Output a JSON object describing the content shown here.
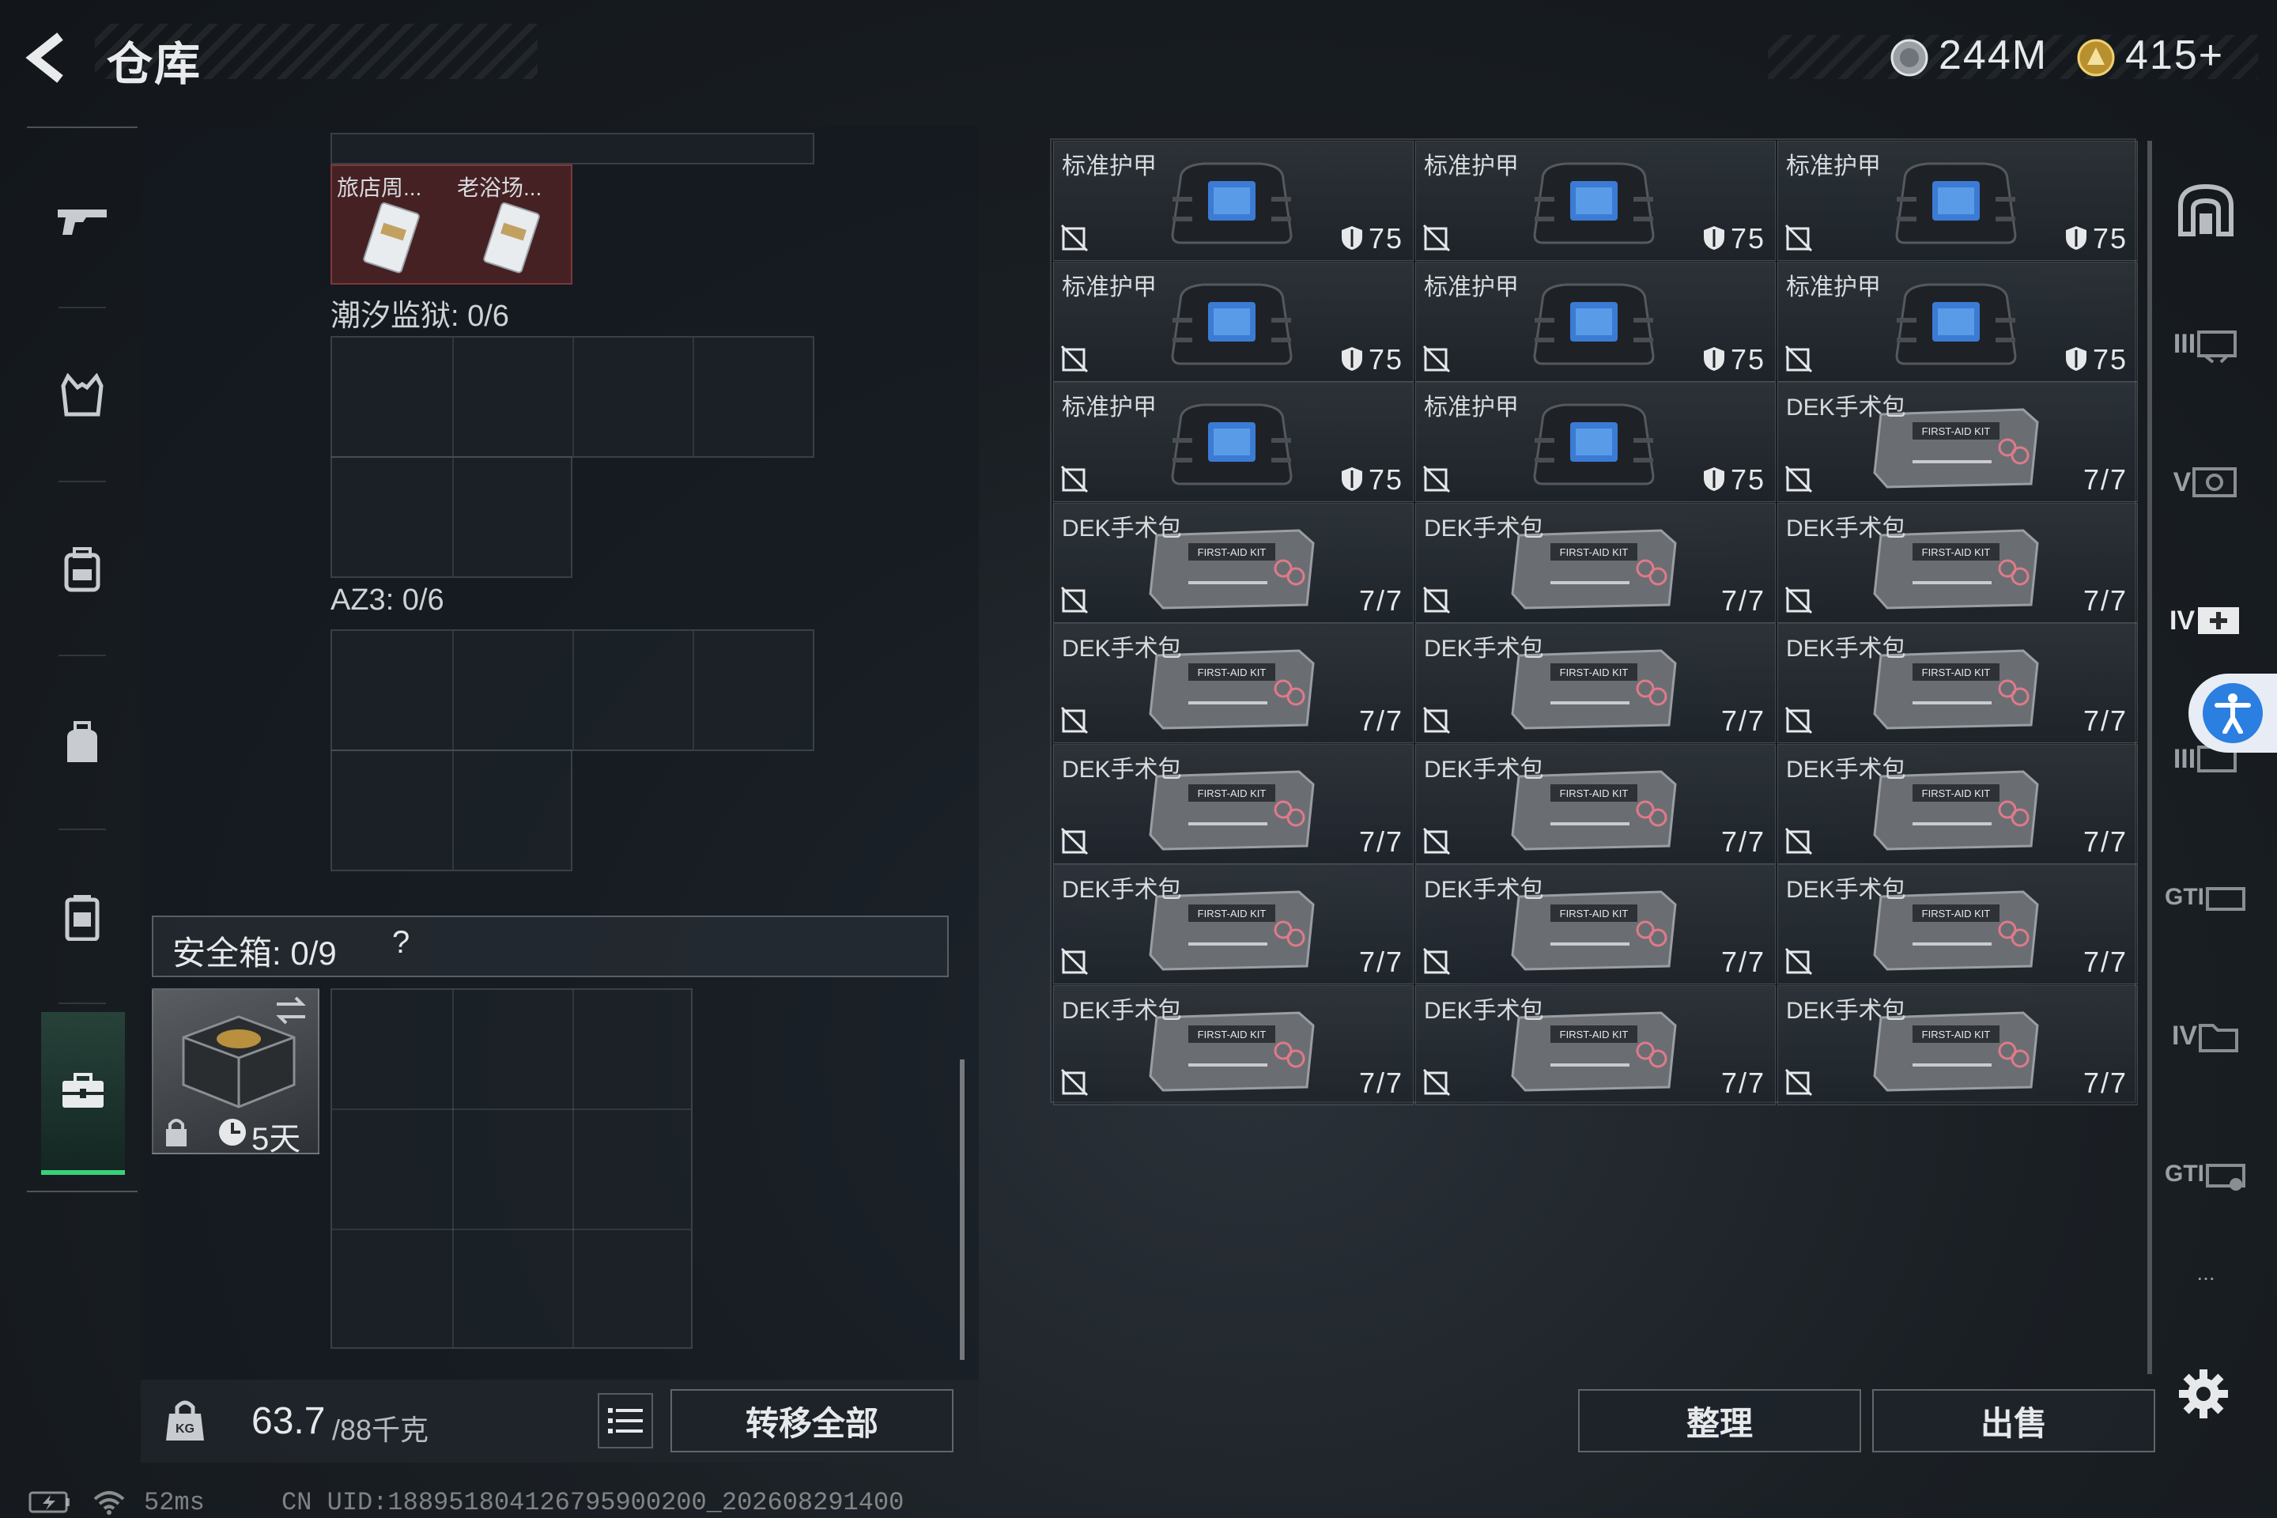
{
  "header": {
    "title": "仓库",
    "currency_silver": "244M",
    "currency_gold": "415+"
  },
  "left_nav": {
    "items": [
      "gun-icon",
      "vest-icon",
      "backpack-icon",
      "bag-icon",
      "canister-icon",
      "case-icon"
    ],
    "active_index": 5
  },
  "container": {
    "top_items": [
      {
        "label": "旅店周..."
      },
      {
        "label": "老浴场..."
      }
    ],
    "sections": [
      {
        "label": "潮汐监狱: 0/6"
      },
      {
        "label": "AZ3: 0/6"
      }
    ],
    "safe_box": {
      "label": "安全箱: 0/9",
      "help": "?",
      "duration": "5天"
    }
  },
  "bottom_left": {
    "weight": "63.7",
    "weight_max": "/88千克",
    "transfer_label": "转移全部"
  },
  "storage": {
    "slots": [
      {
        "name": "标准护甲",
        "type": "armor",
        "count": "75"
      },
      {
        "name": "标准护甲",
        "type": "armor",
        "count": "75"
      },
      {
        "name": "标准护甲",
        "type": "armor",
        "count": "75"
      },
      {
        "name": "标准护甲",
        "type": "armor",
        "count": "75"
      },
      {
        "name": "标准护甲",
        "type": "armor",
        "count": "75"
      },
      {
        "name": "标准护甲",
        "type": "armor",
        "count": "75"
      },
      {
        "name": "标准护甲",
        "type": "armor",
        "count": "75"
      },
      {
        "name": "标准护甲",
        "type": "armor",
        "count": "75"
      },
      {
        "name": "DEK手术包",
        "type": "kit",
        "count": "7/7"
      },
      {
        "name": "DEK手术包",
        "type": "kit",
        "count": "7/7"
      },
      {
        "name": "DEK手术包",
        "type": "kit",
        "count": "7/7"
      },
      {
        "name": "DEK手术包",
        "type": "kit",
        "count": "7/7"
      },
      {
        "name": "DEK手术包",
        "type": "kit",
        "count": "7/7"
      },
      {
        "name": "DEK手术包",
        "type": "kit",
        "count": "7/7"
      },
      {
        "name": "DEK手术包",
        "type": "kit",
        "count": "7/7"
      },
      {
        "name": "DEK手术包",
        "type": "kit",
        "count": "7/7"
      },
      {
        "name": "DEK手术包",
        "type": "kit",
        "count": "7/7"
      },
      {
        "name": "DEK手术包",
        "type": "kit",
        "count": "7/7"
      },
      {
        "name": "DEK手术包",
        "type": "kit",
        "count": "7/7"
      },
      {
        "name": "DEK手术包",
        "type": "kit",
        "count": "7/7"
      },
      {
        "name": "DEK手术包",
        "type": "kit",
        "count": "7/7"
      },
      {
        "name": "DEK手术包",
        "type": "kit",
        "count": "7/7"
      },
      {
        "name": "DEK手术包",
        "type": "kit",
        "count": "7/7"
      },
      {
        "name": "DEK手术包",
        "type": "kit",
        "count": "7/7"
      }
    ],
    "kit_label": "FIRST-AID KIT"
  },
  "right_nav": {
    "items": [
      {
        "icon": "arch-icon",
        "label": ""
      },
      {
        "icon": "tier-3-armor-icon",
        "label": "III"
      },
      {
        "icon": "tier-5-helmet-icon",
        "label": "V"
      },
      {
        "icon": "tier-4-medkit-icon",
        "label": "IV"
      },
      {
        "icon": "tier-3-medkit-icon",
        "label": "III"
      },
      {
        "icon": "gti-icon",
        "label": "GTI"
      },
      {
        "icon": "tier-4-folder-icon",
        "label": "IV"
      },
      {
        "icon": "gti-tool-icon",
        "label": "GTI"
      },
      {
        "icon": "more-icon",
        "label": "..."
      }
    ]
  },
  "bottom_right": {
    "sort_label": "整理",
    "sell_label": "出售"
  },
  "status_bar": {
    "ping": "52ms",
    "uid": "CN UID:188951804126795900200_202608291400"
  },
  "colors": {
    "accent_green": "#3ad07a",
    "accessibility_blue": "#2a7fe0"
  }
}
